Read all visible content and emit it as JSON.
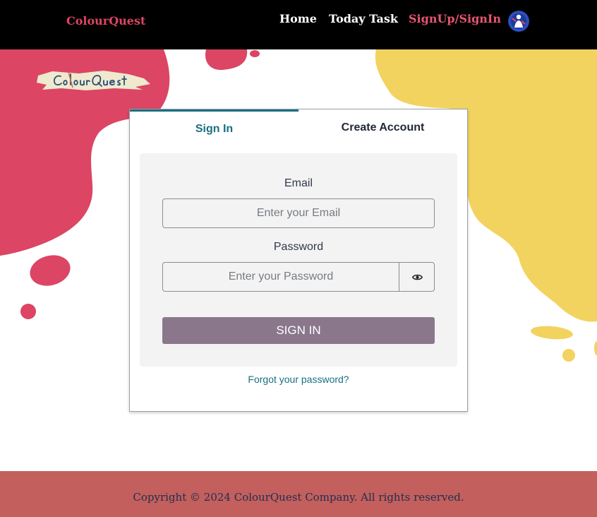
{
  "navbar": {
    "brand": "ColourQuest",
    "links": [
      "Home",
      "Today Task",
      "SignUp/SignIn"
    ],
    "active_link": "SignUp/SignIn",
    "avatar_icon": "user-avatar-icon"
  },
  "logo": {
    "text": "ColourQuest"
  },
  "auth": {
    "tabs": [
      "Sign In",
      "Create Account"
    ],
    "active_tab": "Sign In",
    "email_label": "Email",
    "email_value": "",
    "email_placeholder": "Enter your Email",
    "password_label": "Password",
    "password_value": "",
    "password_placeholder": "Enter your Password",
    "toggle_password_icon": "eye-icon",
    "submit_label": "SIGN IN",
    "forgot_link": "Forgot your password?"
  },
  "footer": {
    "copyright": "Copyright © 2024 ColourQuest Company. All rights reserved."
  },
  "colors": {
    "navbar_bg": "#000000",
    "brand": "#dc4563",
    "active_link": "#e8556f",
    "blob_pink": "#dc4563",
    "blob_yellow": "#f2d35f",
    "accent": "#1b6f82",
    "button": "#8a778c",
    "footer_bg": "#c35f5c",
    "footer_text": "#1f2f52"
  }
}
